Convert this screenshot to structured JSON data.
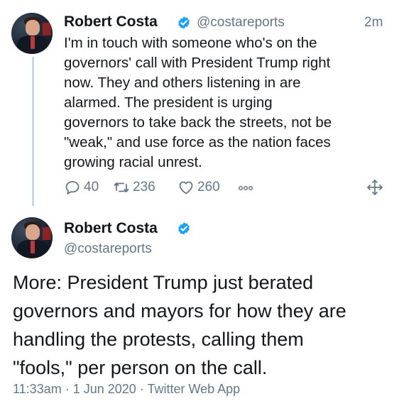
{
  "tweet1": {
    "name": "Robert Costa",
    "handle": "@costareports",
    "time": "2m",
    "text": "I'm in touch with someone who's on the\ngovernors' call with President Trump right\nnow. They and others listening in are\nalarmed. The president is urging\ngovernors to take back the streets, not be\n\"weak,\" and use force as the nation faces\ngrowing racial unrest.",
    "replies": "40",
    "retweets": "236",
    "likes": "260"
  },
  "tweet2": {
    "name": "Robert Costa",
    "handle": "@costareports",
    "text": "More: President Trump just berated\ngovernors and mayors for how they are\nhandling the protests, calling them\n\"fools,\" per person on the call.",
    "meta": "11:33am · 1 Jun 2020 · Twitter Web App"
  },
  "icons": {
    "verified": "verified-badge-icon",
    "reply": "reply-icon",
    "retweet": "retweet-icon",
    "like": "like-icon",
    "more": "more-icon",
    "move": "move-icon"
  },
  "colors": {
    "accent": "#1da1f2",
    "muted": "#657786",
    "text": "#14171a",
    "thread_line": "#ccd6dd"
  }
}
